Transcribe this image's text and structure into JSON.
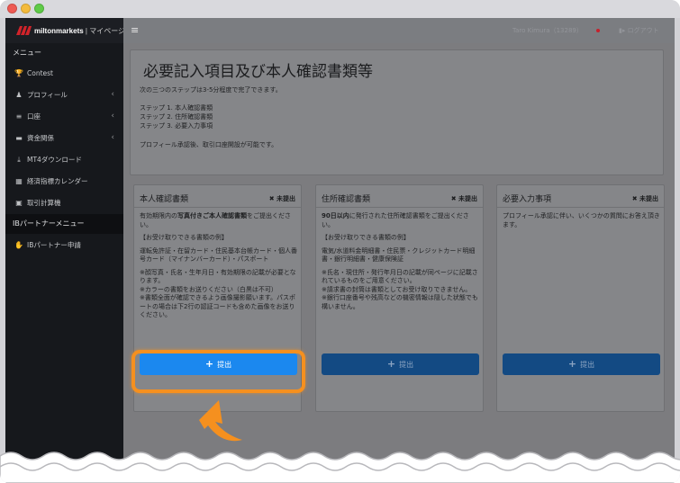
{
  "colors": {
    "sidebar_bg": "#16181c",
    "main_bg": "#7c7c7f",
    "button_active": "#1b88ef",
    "button_dim": "#134a83",
    "highlight": "#f5901f"
  },
  "brand": {
    "name": "miltonmarkets",
    "link": "| マイページ"
  },
  "topbar": {
    "menu_icon": "≡",
    "user_name": "Taro Kimura（13289）",
    "logout": "ログアウト"
  },
  "sidebar": {
    "menu_header": "メニュー",
    "items": [
      {
        "label": "Contest",
        "icon": "trophy-icon",
        "glyph": "🏆",
        "chevron": ""
      },
      {
        "label": "プロフィール",
        "icon": "user-icon",
        "glyph": "♟",
        "chevron": "‹"
      },
      {
        "label": "口座",
        "icon": "list-icon",
        "glyph": "≡",
        "chevron": "‹"
      },
      {
        "label": "資金関係",
        "icon": "money-icon",
        "glyph": "▬",
        "chevron": "‹"
      },
      {
        "label": "MT4ダウンロード",
        "icon": "download-icon",
        "glyph": "⤓",
        "chevron": ""
      },
      {
        "label": "経済指標カレンダー",
        "icon": "calendar-icon",
        "glyph": "▦",
        "chevron": ""
      },
      {
        "label": "取引計算機",
        "icon": "calculator-icon",
        "glyph": "▣",
        "chevron": ""
      }
    ],
    "ib_header": "IBパートナーメニュー",
    "ib_item": {
      "label": "IBパートナー申請",
      "icon": "handshake-icon",
      "glyph": "✋"
    }
  },
  "intro": {
    "title": "必要記入項目及び本人確認書類等",
    "lead": "次の三つのステップは3-5分程度で完了できます。",
    "steps": [
      "ステップ 1. 本人確認書類",
      "ステップ 2. 住所確認書類",
      "ステップ 3. 必要入力事項"
    ],
    "note": "プロフィール承認後、取引口座開設が可能です。"
  },
  "cards": [
    {
      "title": "本人確認書類",
      "status": "✖ 未提出",
      "p1_pre": "有効期限内の",
      "p1_bold": "写真付きご本人確認書類",
      "p1_post": "をご提出ください。",
      "p2": "【お受け取りできる書類の例】",
      "p3": "運転免許証・在留カード・住民基本台帳カード・個人番号カード（マイナンバーカード）・パスポート",
      "p4": "※顔写真・氏名・生年月日・有効期限の記載が必要となります。\n※カラーの書類をお送りください（白黒は不可）\n※書類全面が確認できるよう画像撮影願います。パスポートの場合は下2行の認証コードも含めた画像をお送りください。",
      "button": "提出"
    },
    {
      "title": "住所確認書類",
      "status": "✖ 未提出",
      "p1_pre": "",
      "p1_bold": "90日以内",
      "p1_post": "に発行された住所確認書類をご提出ください。",
      "p2": "【お受け取りできる書類の例】",
      "p3": "電気/水道料金明細書・住民票・クレジットカード明細書・銀行明細書・健康保険証",
      "p4": "※氏名・現住所・発行年月日の記載が同ページに記載されているものをご用意ください。\n※請求書の封筒は書類としてお受け取りできません。\n※銀行口座番号や残高などの機密情報は隠した状態でも構いません。",
      "button": "提出"
    },
    {
      "title": "必要入力事項",
      "status": "✖ 未提出",
      "p1_pre": "プロフィール承認に伴い、いくつかの質問にお答え頂きます。",
      "p1_bold": "",
      "p1_post": "",
      "p2": "",
      "p3": "",
      "p4": "",
      "button": "提出"
    }
  ]
}
